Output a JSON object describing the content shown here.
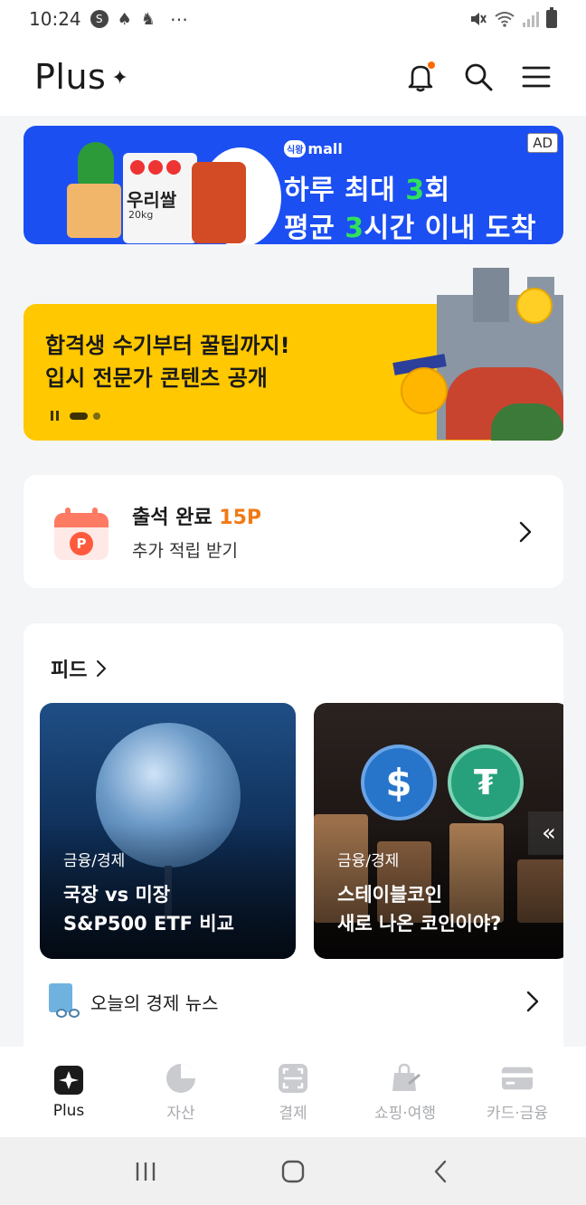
{
  "status_bar": {
    "time": "10:24",
    "left_icons": [
      "S",
      "♠",
      "♞"
    ],
    "more": "⋯"
  },
  "header": {
    "title": "Plus",
    "star": "✦"
  },
  "ad": {
    "brand_badge": "식왕",
    "brand_name": "mall",
    "line1_pre": "하루 최대 ",
    "line1_hl": "3",
    "line1_post": "회",
    "line2_pre": "평균 ",
    "line2_hl": "3",
    "line2_post": "시간 이내 도착",
    "tag": "AD",
    "product_label": "우리쌀",
    "product_sub": "20kg",
    "accent_color": "#1c4ff2"
  },
  "promo": {
    "line1": "합격생 수기부터 꿀팁까지!",
    "line2": "입시 전문가 콘텐츠 공개",
    "background": "#ffc800"
  },
  "attendance": {
    "title": "출석 완료 ",
    "points": "15P",
    "subtitle": "추가 적립 받기",
    "coin_letter": "P"
  },
  "feed": {
    "title": "피드",
    "tiles": [
      {
        "category": "금융/경제",
        "title_line1": "국장 vs 미장",
        "title_line2": "S&P500 ETF 비교"
      },
      {
        "category": "금융/경제",
        "title_line1": "스테이블코인",
        "title_line2": "새로 나온 코인이야?"
      }
    ],
    "scroll_hint": "«",
    "news_label": "오늘의 경제 뉴스"
  },
  "coins": {
    "usdc_symbol": "$",
    "usdt_symbol": "₮"
  },
  "bottom_nav": [
    {
      "label": "Plus",
      "active": true
    },
    {
      "label": "자산",
      "active": false
    },
    {
      "label": "결제",
      "active": false
    },
    {
      "label": "쇼핑·여행",
      "active": false
    },
    {
      "label": "카드·금융",
      "active": false
    }
  ]
}
